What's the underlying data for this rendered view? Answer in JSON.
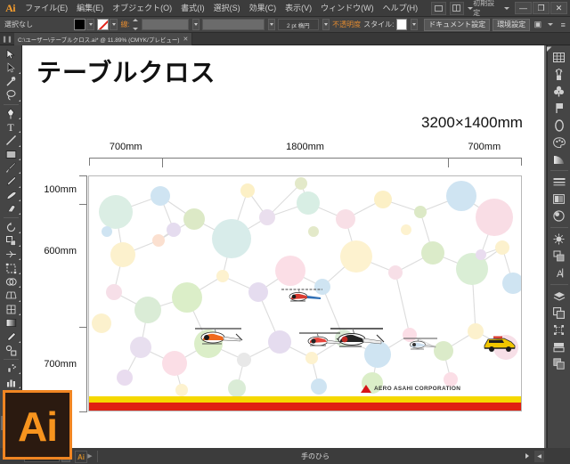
{
  "app": {
    "name": "Adobe Illustrator",
    "logo_text": "Ai",
    "workspace": "初期設定",
    "icon_overlay_label": "Ai"
  },
  "menubar": {
    "items": [
      {
        "label": "ファイル(E)",
        "name": "menu-file"
      },
      {
        "label": "編集(E)",
        "name": "menu-edit"
      },
      {
        "label": "オブジェクト(O)",
        "name": "menu-object"
      },
      {
        "label": "書式(I)",
        "name": "menu-type"
      },
      {
        "label": "選択(S)",
        "name": "menu-select"
      },
      {
        "label": "効果(C)",
        "name": "menu-effect"
      },
      {
        "label": "表示(V)",
        "name": "menu-view"
      },
      {
        "label": "ウィンドウ(W)",
        "name": "menu-window"
      },
      {
        "label": "ヘルプ(H)",
        "name": "menu-help"
      }
    ],
    "window_buttons": {
      "minimize": "—",
      "maximize": "❐",
      "close": "✕"
    }
  },
  "controlbar": {
    "selection_status": "選択なし",
    "fill_label": "fill",
    "stroke_label": "stroke",
    "stroke_weight_label": "線:",
    "stroke_weight_value": "",
    "stroke_profile_value": "",
    "brush_value": "2 pt 楕円",
    "opacity_label": "不透明度",
    "style_label": "スタイル:",
    "document_setup_button": "ドキュメント設定",
    "preferences_button": "環境設定"
  },
  "tabbar": {
    "document_tab": "C:\\ユーザー\\テーブルクロス.ai* @ 11.89% (CMYK/プレビュー)",
    "close_glyph": "✕"
  },
  "toolbar": {
    "tools": [
      {
        "name": "selection-tool",
        "icon": "cursor-arrow-icon"
      },
      {
        "name": "direct-selection-tool",
        "icon": "direct-select-icon"
      },
      {
        "name": "magic-wand-tool",
        "icon": "magic-wand-icon"
      },
      {
        "name": "lasso-tool",
        "icon": "lasso-icon"
      },
      {
        "name": "pen-tool",
        "icon": "pen-icon"
      },
      {
        "name": "type-tool",
        "icon": "type-t-icon"
      },
      {
        "name": "line-segment-tool",
        "icon": "line-icon"
      },
      {
        "name": "rectangle-tool",
        "icon": "rectangle-icon"
      },
      {
        "name": "paintbrush-tool",
        "icon": "paintbrush-icon"
      },
      {
        "name": "pencil-tool",
        "icon": "pencil-icon"
      },
      {
        "name": "blob-brush-tool",
        "icon": "blob-brush-icon"
      },
      {
        "name": "eraser-tool",
        "icon": "eraser-icon"
      },
      {
        "name": "rotate-tool",
        "icon": "rotate-icon"
      },
      {
        "name": "scale-tool",
        "icon": "scale-icon"
      },
      {
        "name": "width-tool",
        "icon": "width-icon"
      },
      {
        "name": "free-transform-tool",
        "icon": "free-transform-icon"
      },
      {
        "name": "shape-builder-tool",
        "icon": "shape-builder-icon"
      },
      {
        "name": "perspective-grid-tool",
        "icon": "perspective-grid-icon"
      },
      {
        "name": "mesh-tool",
        "icon": "mesh-icon"
      },
      {
        "name": "gradient-tool",
        "icon": "gradient-icon"
      },
      {
        "name": "eyedropper-tool",
        "icon": "eyedropper-icon"
      },
      {
        "name": "blend-tool",
        "icon": "blend-icon"
      },
      {
        "name": "symbol-sprayer-tool",
        "icon": "symbol-sprayer-icon"
      },
      {
        "name": "column-graph-tool",
        "icon": "bar-graph-icon"
      },
      {
        "name": "artboard-tool",
        "icon": "artboard-icon"
      },
      {
        "name": "slice-tool",
        "icon": "slice-knife-icon"
      },
      {
        "name": "hand-tool",
        "icon": "hand-icon",
        "selected": true
      },
      {
        "name": "zoom-tool",
        "icon": "magnifier-icon"
      }
    ]
  },
  "rightdock": {
    "panels": [
      {
        "name": "panel-color-guide",
        "icon": "color-grid-icon"
      },
      {
        "name": "panel-brushes",
        "icon": "brush-tip-icon"
      },
      {
        "name": "panel-symbols",
        "icon": "clover-icon"
      },
      {
        "name": "panel-flag",
        "icon": "flag-icon"
      },
      {
        "name": "panel-transparency",
        "icon": "o-shape-icon"
      },
      {
        "name": "panel-color",
        "icon": "palette-icon"
      },
      {
        "name": "panel-gradient",
        "icon": "gradient-wedge-icon"
      },
      {
        "name": "panel-stroke",
        "icon": "stroke-lines-icon"
      },
      {
        "name": "panel-appearance",
        "icon": "appearance-box-icon"
      },
      {
        "name": "panel-graphic-styles",
        "icon": "sphere-icon"
      },
      {
        "name": "panel-pathfinder",
        "icon": "starburst-icon"
      },
      {
        "name": "panel-align",
        "icon": "align-icon"
      },
      {
        "name": "panel-character",
        "icon": "text-a-icon"
      },
      {
        "name": "panel-layers",
        "icon": "layers-icon"
      },
      {
        "name": "panel-artboards",
        "icon": "artboards-icon"
      },
      {
        "name": "panel-links",
        "icon": "links-grid-icon"
      },
      {
        "name": "panel-separations",
        "icon": "separations-icon"
      },
      {
        "name": "panel-transform",
        "icon": "transform-icon"
      }
    ]
  },
  "statusbar": {
    "zoom_level": "11.89%",
    "current_tool": "手のひら",
    "prev_glyph": "◀",
    "next_glyph": "▶"
  },
  "artboard": {
    "title": "テーブルクロス",
    "total_dimension": "3200×1400mm",
    "horizontal_dimensions": [
      {
        "label": "700mm",
        "center_pct": 8.5
      },
      {
        "label": "1800mm",
        "center_pct": 50
      },
      {
        "label": "700mm",
        "center_pct": 91.5
      },
      {
        "label": "",
        "center_pct": 0
      }
    ],
    "horizontal_ticks_pct": [
      0,
      17,
      83,
      100
    ],
    "vertical_dimensions": [
      {
        "label": "100mm",
        "center_pct": 6
      },
      {
        "label": "600mm",
        "center_pct": 32
      },
      {
        "label": "700mm",
        "center_pct": 80
      }
    ],
    "vertical_ticks_pct": [
      0,
      12,
      64,
      100
    ],
    "logo_text": "AERO ASAHI CORPORATION",
    "stripe_colors": {
      "yellow": "#f5d800",
      "red": "#e01f12"
    },
    "bubble_palette": [
      "#dff0e8",
      "#cfe5f5",
      "#f7e2c9",
      "#f9e0e8",
      "#e3e9c7",
      "#e5dcef",
      "#fdf3cf",
      "#d9ecd6",
      "#fbdde4",
      "#d6ecef"
    ],
    "aircraft": [
      {
        "name": "helicopter-red-white-1"
      },
      {
        "name": "helicopter-orange-white-2"
      },
      {
        "name": "helicopter-black-red-3"
      },
      {
        "name": "helicopter-blue-white-4"
      },
      {
        "name": "helicopter-small-5"
      },
      {
        "name": "vehicle-yellow-6"
      }
    ]
  },
  "colors": {
    "accent": "#f7941e",
    "ui_bg": "#454545",
    "canvas": "#ffffff",
    "orange_text": "#e08a30"
  }
}
